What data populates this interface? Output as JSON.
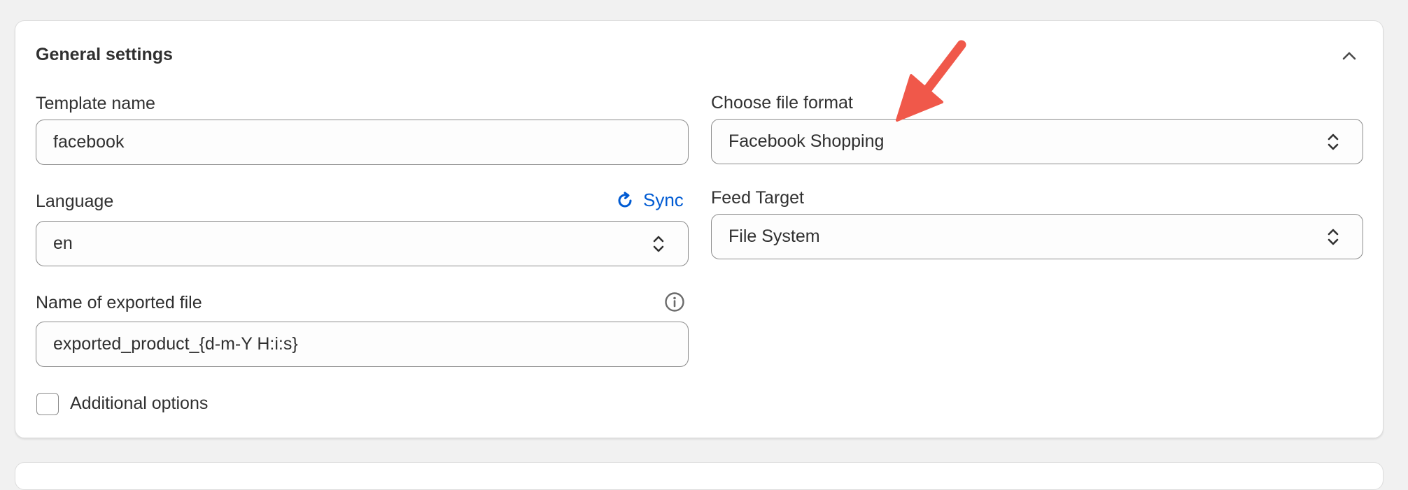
{
  "section": {
    "title": "General settings"
  },
  "fields": {
    "template_name": {
      "label": "Template name",
      "value": "facebook"
    },
    "file_format": {
      "label": "Choose file format",
      "value": "Facebook Shopping"
    },
    "language": {
      "label": "Language",
      "value": "en",
      "sync_label": "Sync"
    },
    "feed_target": {
      "label": "Feed Target",
      "value": "File System"
    },
    "exported_file": {
      "label": "Name of exported file",
      "value": "exported_product_{d-m-Y H:i:s}"
    },
    "additional_options": {
      "label": "Additional options",
      "checked": false
    }
  },
  "icons": {
    "collapse": "chevron-up-icon",
    "select": "select-chevrons-icon",
    "sync": "refresh-icon",
    "info": "info-icon",
    "annotation": "arrow-annotation"
  },
  "colors": {
    "link": "#005bd3",
    "annotation": "#f0584a",
    "border": "#8c8c8c"
  }
}
